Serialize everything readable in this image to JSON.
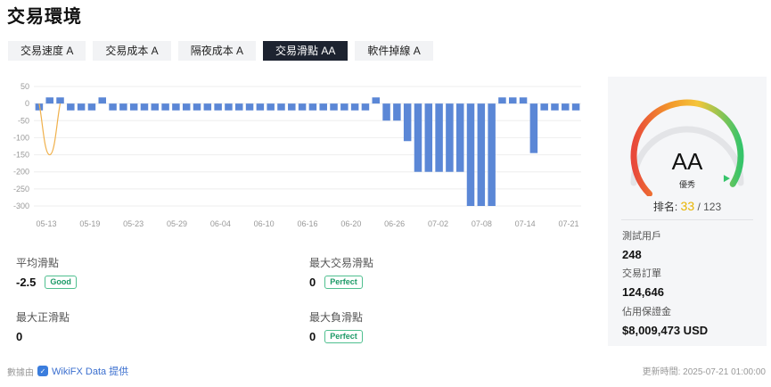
{
  "title": "交易環境",
  "tabs": [
    {
      "label": "交易速度 A",
      "active": false
    },
    {
      "label": "交易成本 A",
      "active": false
    },
    {
      "label": "隔夜成本 A",
      "active": false
    },
    {
      "label": "交易滑點 AA",
      "active": true
    },
    {
      "label": "軟件掉線 A",
      "active": false
    }
  ],
  "chart_data": {
    "type": "bar",
    "y_ticks": [
      50,
      0,
      -50,
      -100,
      -150,
      -200,
      -250,
      -300
    ],
    "ylim": [
      -300,
      50
    ],
    "x_tick_labels": [
      "05-13",
      "05-19",
      "05-23",
      "05-29",
      "06-04",
      "06-10",
      "06-16",
      "06-20",
      "06-26",
      "07-02",
      "07-08",
      "07-14",
      "07-21"
    ],
    "values": [
      -20,
      18,
      18,
      -20,
      -20,
      -20,
      18,
      -20,
      -20,
      -20,
      -20,
      -20,
      -20,
      -20,
      -20,
      -20,
      -20,
      -20,
      -20,
      -20,
      -20,
      -20,
      -20,
      -20,
      -20,
      -20,
      -20,
      -20,
      -20,
      -20,
      -20,
      -20,
      18,
      -50,
      -50,
      -110,
      -200,
      -200,
      -200,
      -200,
      -200,
      -300,
      -300,
      -300,
      18,
      18,
      18,
      -145,
      -20,
      -20,
      -20,
      -20
    ],
    "bar_color": "#5b87d6",
    "line_color": "#f0b04a",
    "line_points": [
      [
        0,
        0
      ],
      [
        1,
        -150
      ],
      [
        2,
        0
      ]
    ],
    "grid": true
  },
  "stats": {
    "avg_slip": {
      "label": "平均滑點",
      "value": "-2.5",
      "badge": "Good"
    },
    "max_trade_slip": {
      "label": "最大交易滑點",
      "value": "0",
      "badge": "Perfect"
    },
    "max_pos_slip": {
      "label": "最大正滑點",
      "value": "0"
    },
    "max_neg_slip": {
      "label": "最大負滑點",
      "value": "0",
      "badge": "Perfect"
    }
  },
  "panel": {
    "grade": "AA",
    "grade_sub": "優秀",
    "rank_label": "排名:",
    "rank_value": "33",
    "rank_total": "/ 123",
    "test_users_label": "測試用戶",
    "test_users_value": "248",
    "orders_label": "交易訂單",
    "orders_value": "124,646",
    "margin_label": "佔用保證金",
    "margin_value": "$8,009,473 USD",
    "gauge_level": 0.95
  },
  "footer": {
    "source_prefix": "數據由",
    "source_brand": "WikiFX Data 提供",
    "updated": "更新時間: 2025-07-21 01:00:00"
  }
}
